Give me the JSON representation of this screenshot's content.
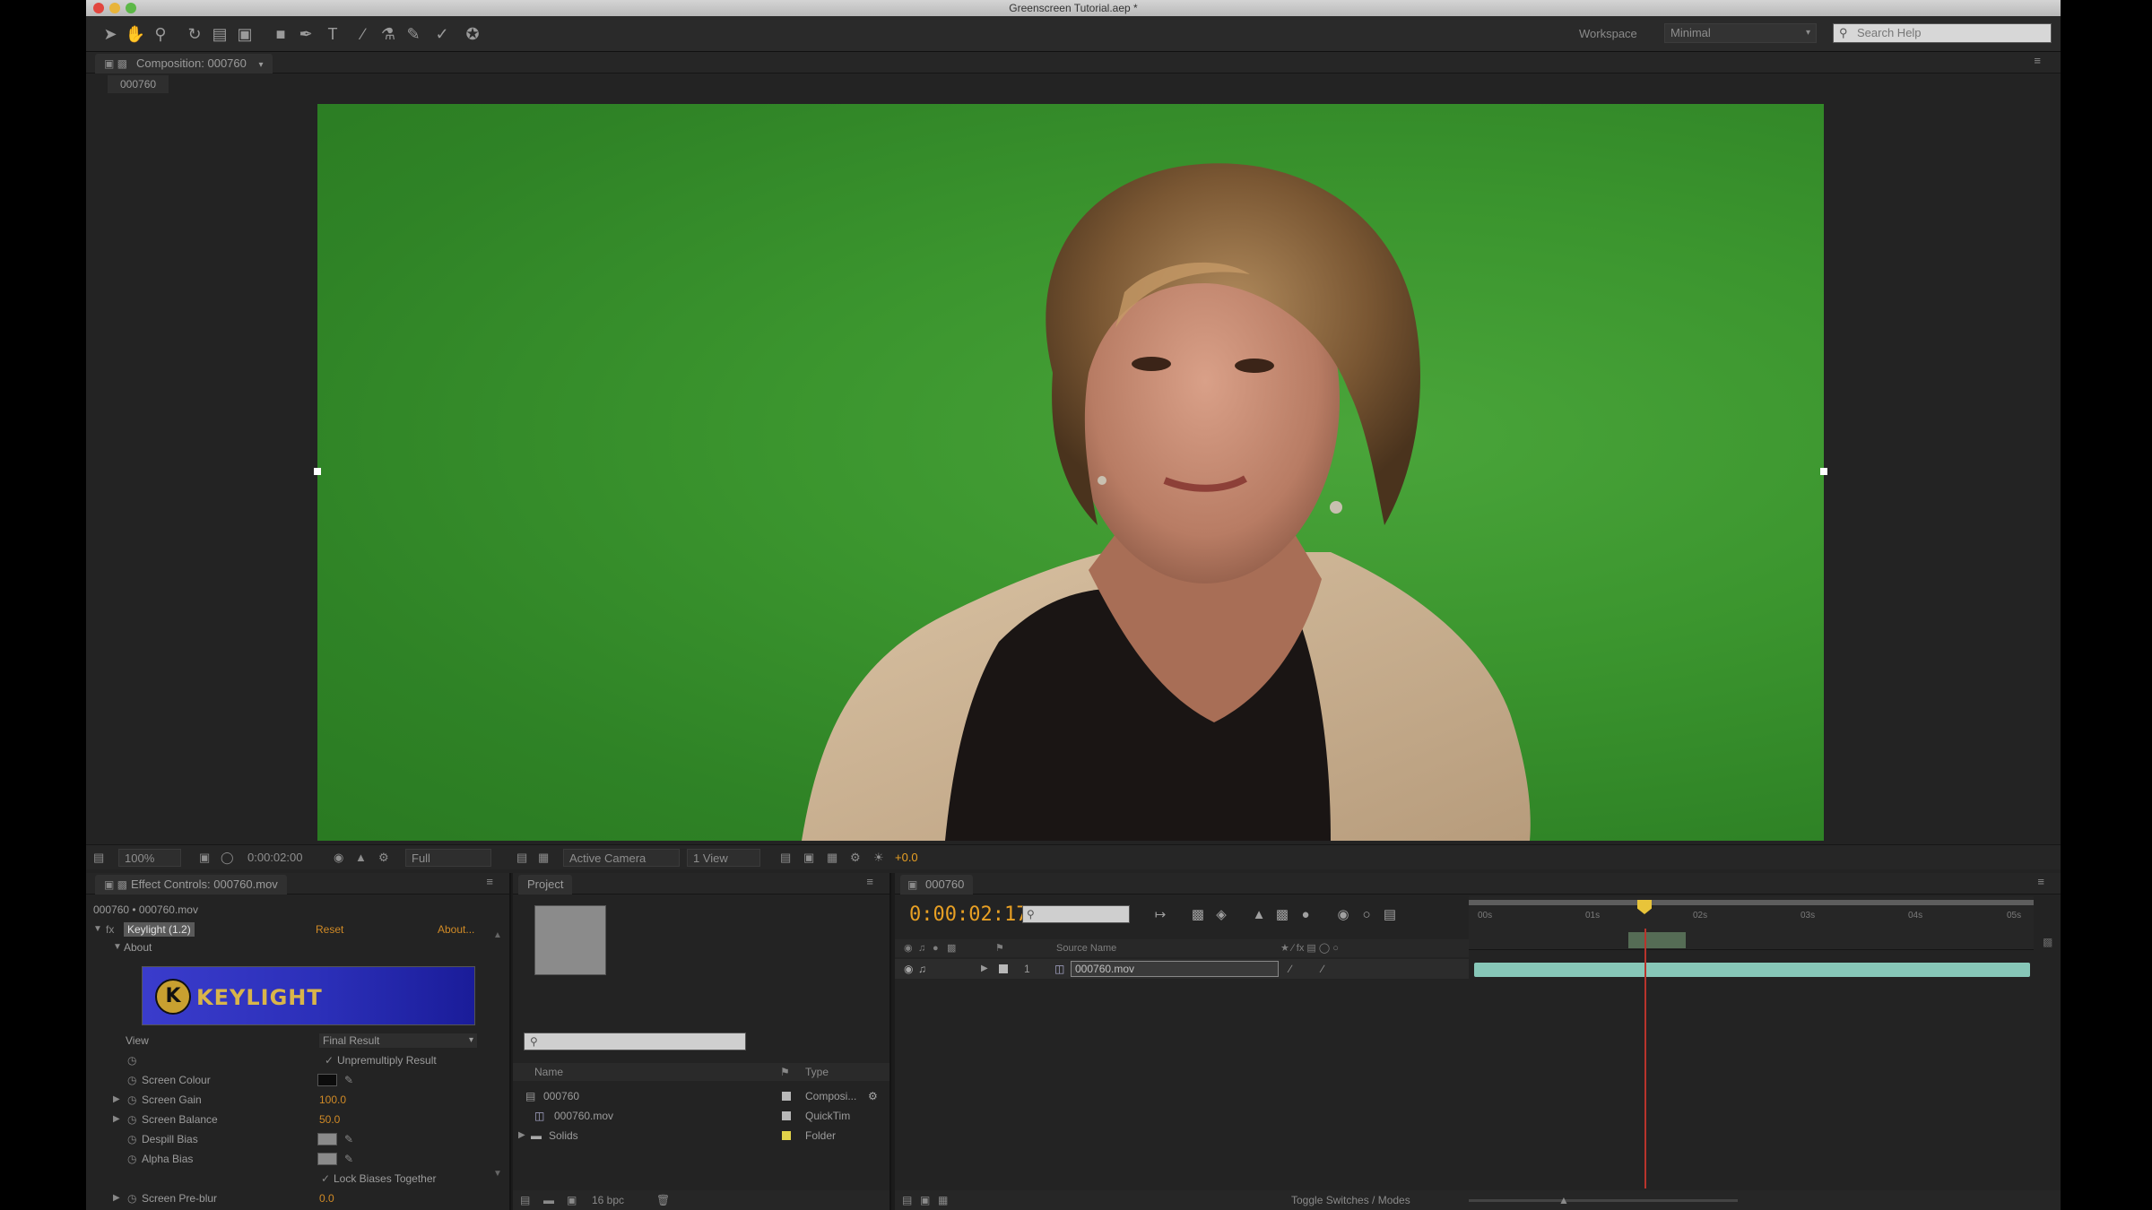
{
  "app": {
    "title": "Greenscreen Tutorial.aep *",
    "workspace_label": "Workspace",
    "workspace_value": "Minimal",
    "search_help_placeholder": "Search Help"
  },
  "composition_panel": {
    "tab_label": "Composition: 000760",
    "sub_tab": "000760"
  },
  "viewer_controls": {
    "zoom": "100%",
    "time": "0:00:02:00",
    "resolution": "Full",
    "camera": "Active Camera",
    "views": "1 View",
    "exposure": "+0.0"
  },
  "effect_controls": {
    "tab_label": "Effect Controls: 000760.mov",
    "breadcrumb": "000760 • 000760.mov",
    "effect_name": "Keylight (1.2)",
    "reset_label": "Reset",
    "about_label": "About...",
    "about_row": "About",
    "banner_text": "KEYLIGHT",
    "properties": [
      {
        "label": "View",
        "value": "Final Result"
      },
      {
        "label": "",
        "value": "Unpremultiply Result"
      },
      {
        "label": "Screen Colour",
        "value": ""
      },
      {
        "label": "Screen Gain",
        "value": "100.0"
      },
      {
        "label": "Screen Balance",
        "value": "50.0"
      },
      {
        "label": "Despill Bias",
        "value": ""
      },
      {
        "label": "Alpha Bias",
        "value": ""
      },
      {
        "label": "",
        "value": "Lock Biases Together"
      },
      {
        "label": "Screen Pre-blur",
        "value": "0.0"
      }
    ]
  },
  "project": {
    "tab_label": "Project",
    "col_name": "Name",
    "col_type": "Type",
    "items": [
      {
        "name": "000760",
        "type": "Composi..."
      },
      {
        "name": "000760.mov",
        "type": "QuickTim"
      },
      {
        "name": "Solids",
        "type": "Folder"
      }
    ],
    "footer_bpc": "16 bpc"
  },
  "timeline": {
    "tab_label": "000760",
    "timecode": "0:00:02:17",
    "col_source_name": "Source Name",
    "layer_index": "1",
    "layer_name": "000760.mov",
    "ruler_ticks": [
      "00s",
      "01s",
      "02s",
      "03s",
      "04s",
      "05s"
    ],
    "footer_label": "Toggle Switches / Modes"
  },
  "colors": {
    "accent_orange": "#e8a024",
    "green_screen": "#3b952e",
    "layer_bar": "#87c7b8",
    "playhead": "#b8342c"
  }
}
